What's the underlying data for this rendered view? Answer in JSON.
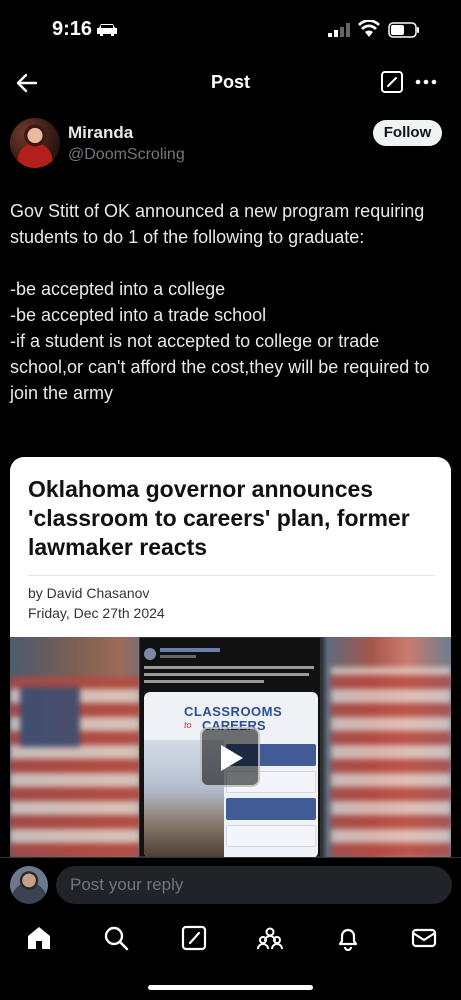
{
  "status": {
    "time": "9:16"
  },
  "nav": {
    "title": "Post"
  },
  "author": {
    "name": "Miranda",
    "handle": "@DoomScroling",
    "follow_label": "Follow"
  },
  "post": {
    "intro": "Gov Stitt of OK announced a new program requiring students to do 1 of the following to graduate:",
    "line1": "-be accepted into a college",
    "line2": "-be accepted into a trade school",
    "line3": "-if a student is not accepted to college or trade school,or can't afford the cost,they will be required to join the army"
  },
  "card": {
    "headline": "Oklahoma governor announces 'classroom to careers' plan, former lawmaker reacts",
    "byline": "by David Chasanov",
    "date": "Friday, Dec 27th 2024",
    "video": {
      "word_top": "CLASSROOMS",
      "word_to": "to",
      "word_bottom": "CAREERS"
    }
  },
  "reply": {
    "placeholder": "Post your reply"
  },
  "tabs": [
    "home-icon",
    "search-icon",
    "compose-icon",
    "communities-icon",
    "notifications-icon",
    "messages-icon"
  ]
}
